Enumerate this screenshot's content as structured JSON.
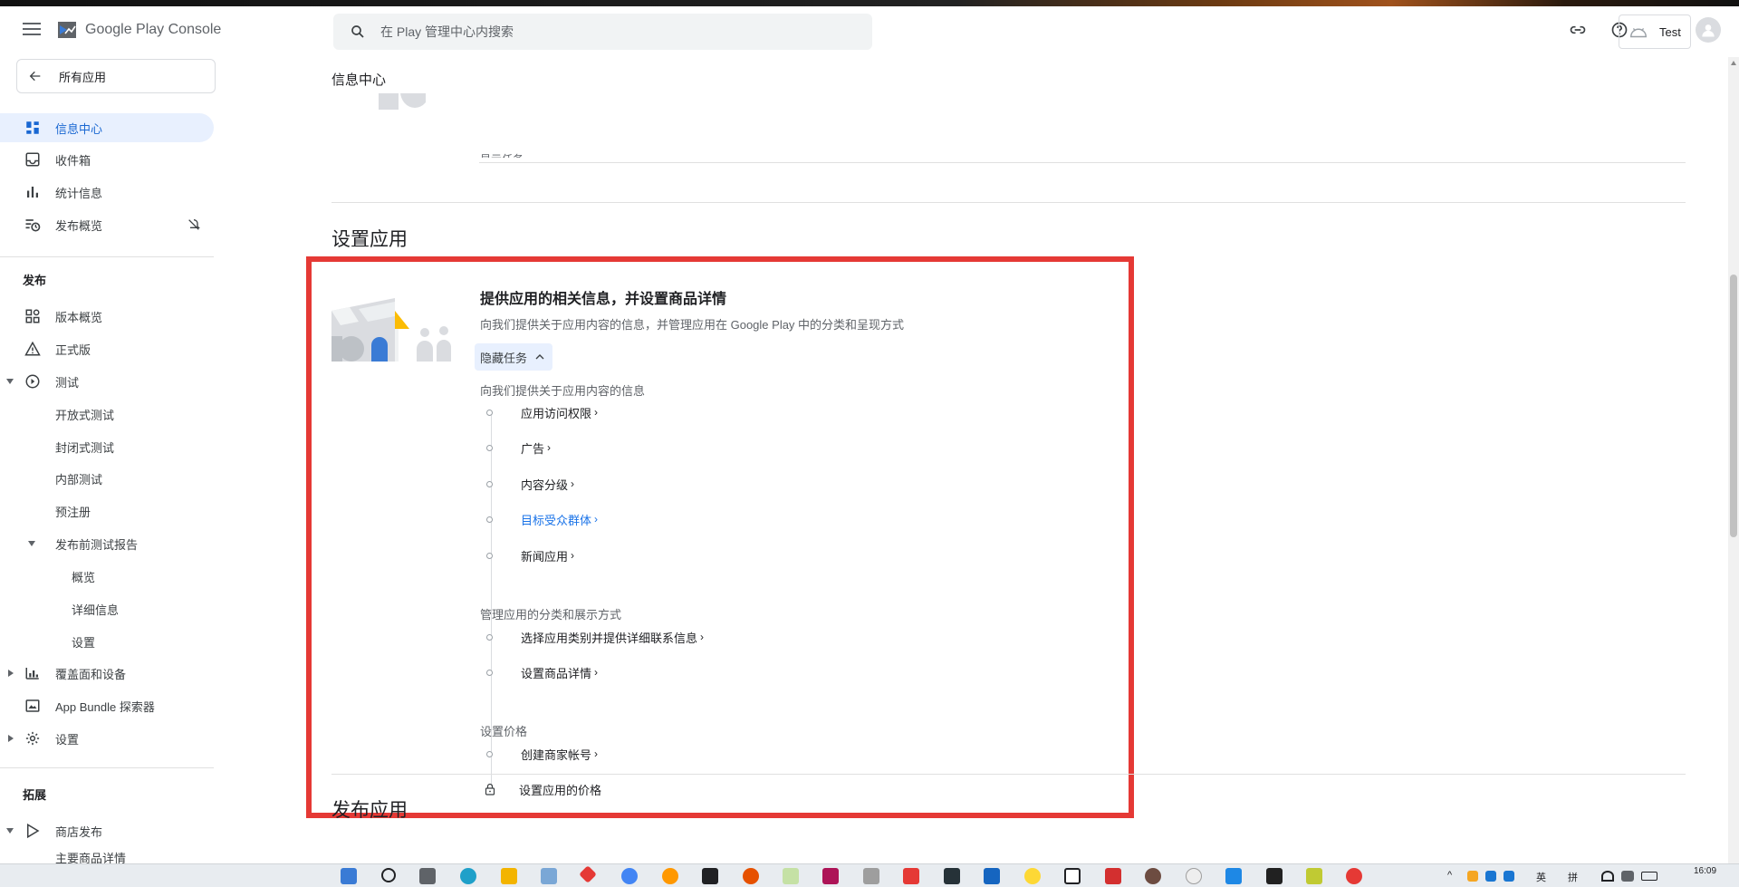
{
  "header": {
    "app_name": "Google Play Console",
    "search_placeholder": "在 Play 管理中心内搜索",
    "account_name": "Test"
  },
  "sidebar": {
    "back_label": "所有应用",
    "items": [
      {
        "label": "信息中心"
      },
      {
        "label": "收件箱"
      },
      {
        "label": "统计信息"
      },
      {
        "label": "发布概览"
      }
    ],
    "section_publish": "发布",
    "publish_items": [
      {
        "label": "版本概览"
      },
      {
        "label": "正式版"
      },
      {
        "label": "测试"
      },
      {
        "label": "开放式测试"
      },
      {
        "label": "封闭式测试"
      },
      {
        "label": "内部测试"
      },
      {
        "label": "预注册"
      },
      {
        "label": "发布前测试报告"
      },
      {
        "label": "概览"
      },
      {
        "label": "详细信息"
      },
      {
        "label": "设置"
      },
      {
        "label": "覆盖面和设备"
      },
      {
        "label": "App Bundle 探索器"
      },
      {
        "label": "设置"
      }
    ],
    "section_expand": "拓展",
    "expand_items": [
      {
        "label": "商店发布"
      },
      {
        "label": "主要商品详情"
      }
    ]
  },
  "main": {
    "page_title": "信息中心",
    "partial_text": "显示任务",
    "section_setup": "设置应用",
    "task_title": "提供应用的相关信息，并设置商品详情",
    "task_desc": "向我们提供关于应用内容的信息，并管理应用在 Google Play 中的分类和呈现方式",
    "hide_tasks": "隐藏任务",
    "groups": [
      {
        "label": "向我们提供关于应用内容的信息",
        "tasks": [
          {
            "label": "应用访问权限",
            "link": false
          },
          {
            "label": "广告",
            "link": false
          },
          {
            "label": "内容分级",
            "link": false
          },
          {
            "label": "目标受众群体",
            "link": true
          },
          {
            "label": "新闻应用",
            "link": false
          }
        ]
      },
      {
        "label": "管理应用的分类和展示方式",
        "tasks": [
          {
            "label": "选择应用类别并提供详细联系信息",
            "link": false
          },
          {
            "label": "设置商品详情",
            "link": false
          }
        ]
      },
      {
        "label": "设置价格",
        "tasks": [
          {
            "label": "创建商家帐号",
            "link": false
          },
          {
            "label": "设置应用的价格",
            "link": false,
            "locked": true
          }
        ]
      }
    ],
    "section_publish_app": "发布应用"
  },
  "taskbar": {
    "time": "16:09",
    "tray_text_1": "英",
    "tray_text_2": "拼"
  },
  "colors": {
    "accent": "#1a73e8",
    "active_bg": "#e8f0fe",
    "highlight_box": "#e53935"
  }
}
